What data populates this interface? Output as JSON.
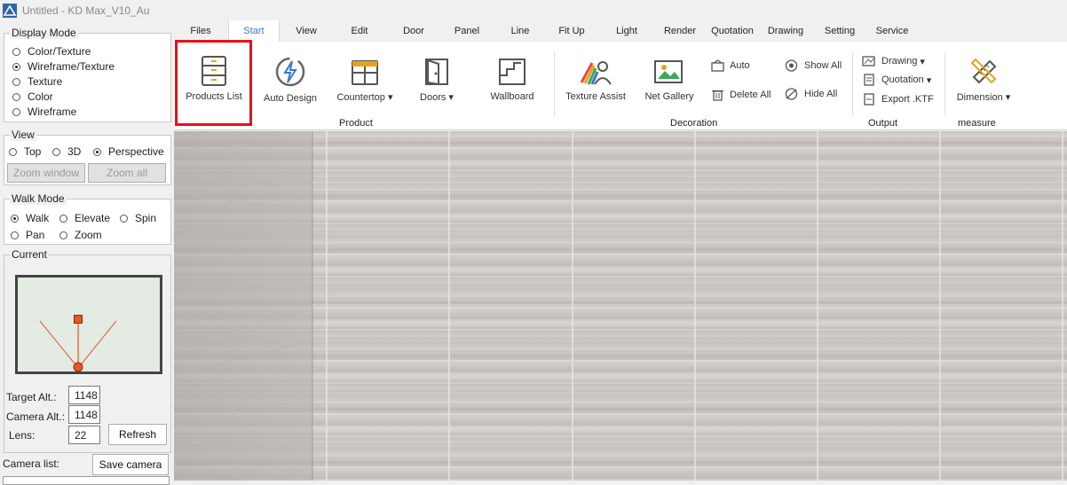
{
  "window": {
    "title": "Untitled - KD Max_V10_Au"
  },
  "tabs": [
    {
      "label": "Files"
    },
    {
      "label": "Start"
    },
    {
      "label": "View"
    },
    {
      "label": "Edit"
    },
    {
      "label": "Door"
    },
    {
      "label": "Panel"
    },
    {
      "label": "Line"
    },
    {
      "label": "Fit Up"
    },
    {
      "label": "Light"
    },
    {
      "label": "Render"
    },
    {
      "label": "Quotation"
    },
    {
      "label": "Drawing"
    },
    {
      "label": "Setting"
    },
    {
      "label": "Service"
    }
  ],
  "active_tab": "Start",
  "ribbon": {
    "products_list": "Products List",
    "auto_design": "Auto Design",
    "countertop": "Countertop",
    "doors": "Doors",
    "wallboard": "Wallboard",
    "texture_assist": "Texture Assist",
    "net_gallery": "Net Gallery",
    "auto": "Auto",
    "delete_all": "Delete All",
    "show_all": "Show All",
    "hide_all": "Hide All",
    "drawing": "Drawing",
    "quotation": "Quotation",
    "export_ktf": "Export .KTF",
    "dimension": "Dimension",
    "groups": {
      "product": "Product",
      "decoration": "Decoration",
      "output": "Output",
      "measure": "measure"
    }
  },
  "display_mode": {
    "legend": "Display Mode",
    "options": [
      "Color/Texture",
      "Wireframe/Texture",
      "Texture",
      "Color",
      "Wireframe"
    ],
    "selected": "Wireframe/Texture"
  },
  "view": {
    "legend": "View",
    "options": [
      "Top",
      "3D",
      "Perspective"
    ],
    "selected": "Perspective",
    "zoom_window": "Zoom window",
    "zoom_all": "Zoom all"
  },
  "walk_mode": {
    "legend": "Walk Mode",
    "options": [
      "Walk",
      "Elevate",
      "Spin",
      "Pan",
      "Zoom"
    ],
    "selected": "Walk"
  },
  "current": {
    "legend": "Current",
    "target_alt_label": "Target Alt.:",
    "target_alt": "1148",
    "camera_alt_label": "Camera Alt.:",
    "camera_alt": "1148",
    "lens_label": "Lens:",
    "lens": "22",
    "refresh": "Refresh"
  },
  "camera_list": {
    "label": "Camera list:",
    "save": "Save camera"
  },
  "colors": {
    "accent": "#3a78c6",
    "highlight": "#e8101a",
    "preview_bg": "#e3ebe3",
    "camera": "#e8562a"
  }
}
